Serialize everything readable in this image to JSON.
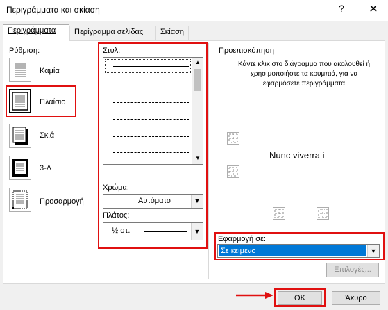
{
  "window": {
    "title": "Περιγράμματα και σκίαση",
    "help": "?",
    "close": "✕"
  },
  "tabs": [
    {
      "label": "Περιγράμματα"
    },
    {
      "label": "Περίγραμμα σελίδας"
    },
    {
      "label": "Σκίαση"
    }
  ],
  "setting": {
    "label": "Ρύθμιση:",
    "options": [
      {
        "label": "Καμία"
      },
      {
        "label": "Πλαίσιο"
      },
      {
        "label": "Σκιά"
      },
      {
        "label": "3-Δ"
      },
      {
        "label": "Προσαρμογή"
      }
    ]
  },
  "style": {
    "label": "Στυλ:",
    "color_label": "Χρώμα:",
    "color_value": "Αυτόματο",
    "width_label": "Πλάτος:",
    "width_value": "½ στ."
  },
  "preview": {
    "label": "Προεπισκόπηση",
    "instructions": "Κάντε κλικ στο διάγραμμα που ακολουθεί ή χρησιμοποιήστε τα κουμπιά, για να εφαρμόσετε περιγράμματα",
    "sample_text": "Nunc viverra i"
  },
  "apply_to": {
    "label": "Εφαρμογή σε:",
    "value": "Σε κείμενο"
  },
  "buttons": {
    "options": "Επιλογές...",
    "ok": "OK",
    "cancel": "Άκυρο"
  },
  "colors": {
    "highlight": "#e01010",
    "selection": "#0078d7"
  }
}
